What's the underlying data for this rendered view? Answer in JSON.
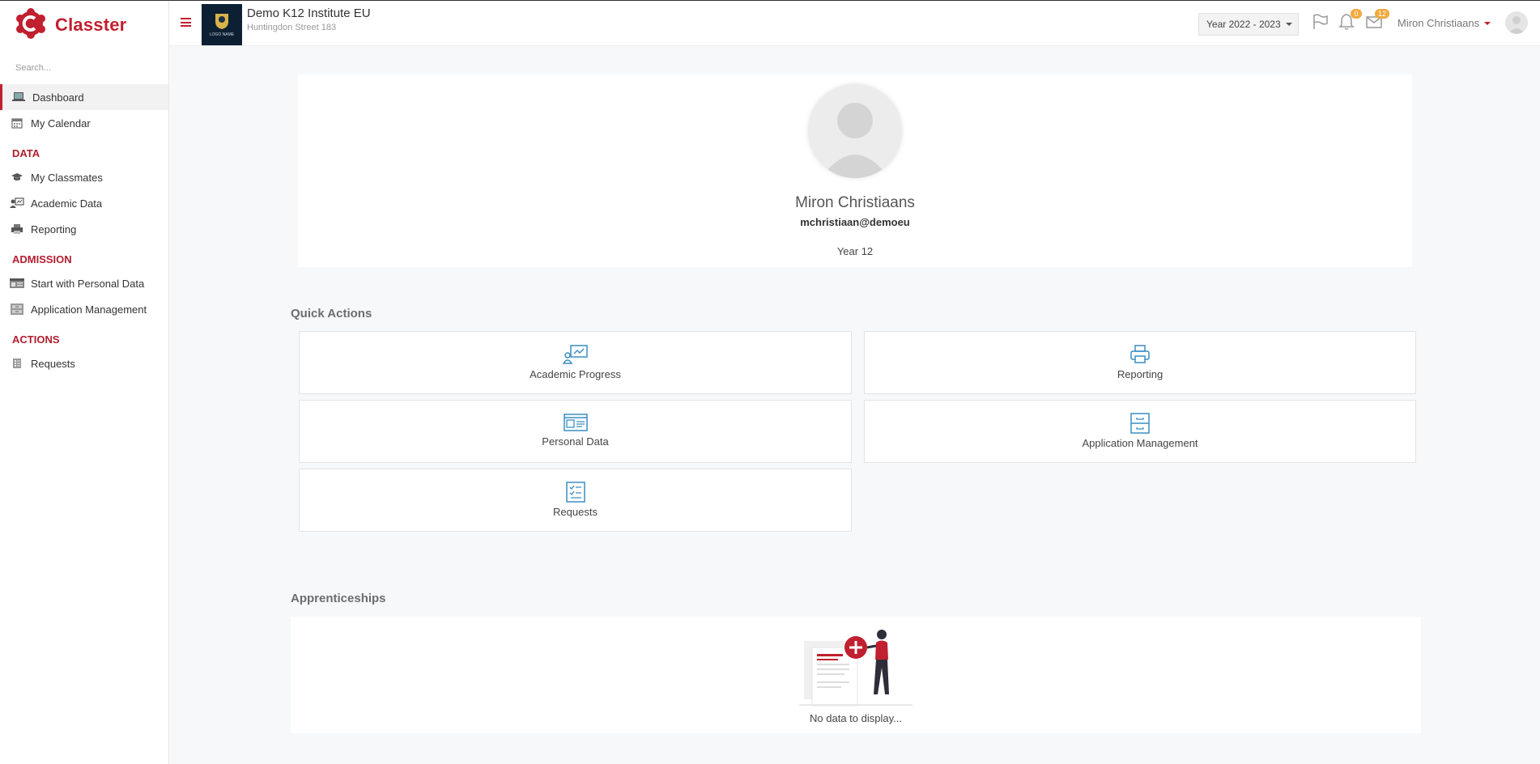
{
  "brand": {
    "name": "Classter"
  },
  "sidebar": {
    "search_placeholder": "Search...",
    "top_items": [
      {
        "label": "Dashboard",
        "icon": "laptop-icon",
        "active": true
      },
      {
        "label": "My Calendar",
        "icon": "calendar-icon"
      }
    ],
    "sections": [
      {
        "title": "DATA",
        "items": [
          {
            "label": "My Classmates",
            "icon": "graduation-cap-icon"
          },
          {
            "label": "Academic Data",
            "icon": "academic-data-icon"
          },
          {
            "label": "Reporting",
            "icon": "printer-icon"
          }
        ]
      },
      {
        "title": "ADMISSION",
        "items": [
          {
            "label": "Start with Personal Data",
            "icon": "id-card-icon"
          },
          {
            "label": "Application Management",
            "icon": "cabinet-icon"
          }
        ]
      },
      {
        "title": "ACTIONS",
        "items": [
          {
            "label": "Requests",
            "icon": "checklist-icon"
          }
        ]
      }
    ]
  },
  "header": {
    "school_name": "Demo K12 Institute EU",
    "school_address": "Huntingdon Street 183",
    "logo_text": "LOGO NAME",
    "year_select": "Year 2022 - 2023",
    "notifications_count": "0",
    "messages_count": "12",
    "user_name": "Miron Christiaans"
  },
  "profile": {
    "name": "Miron Christiaans",
    "email": "mchristiaan@demoeu",
    "year": "Year 12"
  },
  "quick_actions": {
    "title": "Quick Actions",
    "items": [
      {
        "label": "Academic Progress",
        "icon": "academic-progress-icon"
      },
      {
        "label": "Reporting",
        "icon": "printer-icon"
      },
      {
        "label": "Personal Data",
        "icon": "id-card-icon"
      },
      {
        "label": "Application Management",
        "icon": "cabinet-icon"
      },
      {
        "label": "Requests",
        "icon": "checklist-icon"
      }
    ]
  },
  "apprenticeships": {
    "title": "Apprenticeships",
    "empty_text": "No data to display..."
  },
  "colors": {
    "brand_red": "#c0202f",
    "icon_blue": "#3a8ec4",
    "badge_orange": "#f2a93b"
  }
}
